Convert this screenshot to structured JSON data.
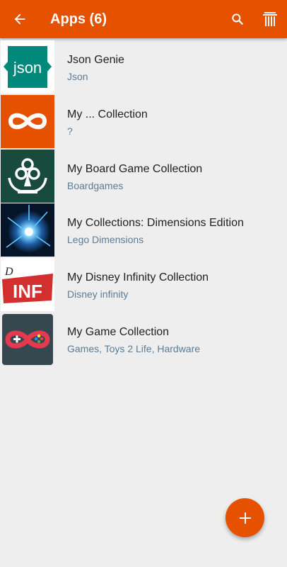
{
  "appbar": {
    "title": "Apps (6)",
    "back_icon": "arrow-left-icon",
    "search_icon": "search-icon",
    "delete_icon": "delete-icon"
  },
  "items": [
    {
      "title": "Json Genie",
      "subtitle": "Json",
      "icon": "json-icon",
      "thumb_text": "json"
    },
    {
      "title": "My ... Collection",
      "subtitle": "?",
      "icon": "infinity-icon"
    },
    {
      "title": "My Board Game Collection",
      "subtitle": "Boardgames",
      "icon": "board-game-icon"
    },
    {
      "title": "My Collections: Dimensions Edition",
      "subtitle": "Lego Dimensions",
      "icon": "portal-icon"
    },
    {
      "title": "My Disney Infinity Collection",
      "subtitle": "Disney infinity",
      "icon": "disney-infinity-logo",
      "thumb_text": "INF"
    },
    {
      "title": "My Game Collection",
      "subtitle": "Games, Toys 2 Life, Hardware",
      "icon": "gamepad-icon"
    }
  ],
  "fab": {
    "icon": "plus-icon"
  },
  "colors": {
    "primary": "#e65100",
    "subtitle": "#5b7c96",
    "background": "#eeeeee"
  }
}
